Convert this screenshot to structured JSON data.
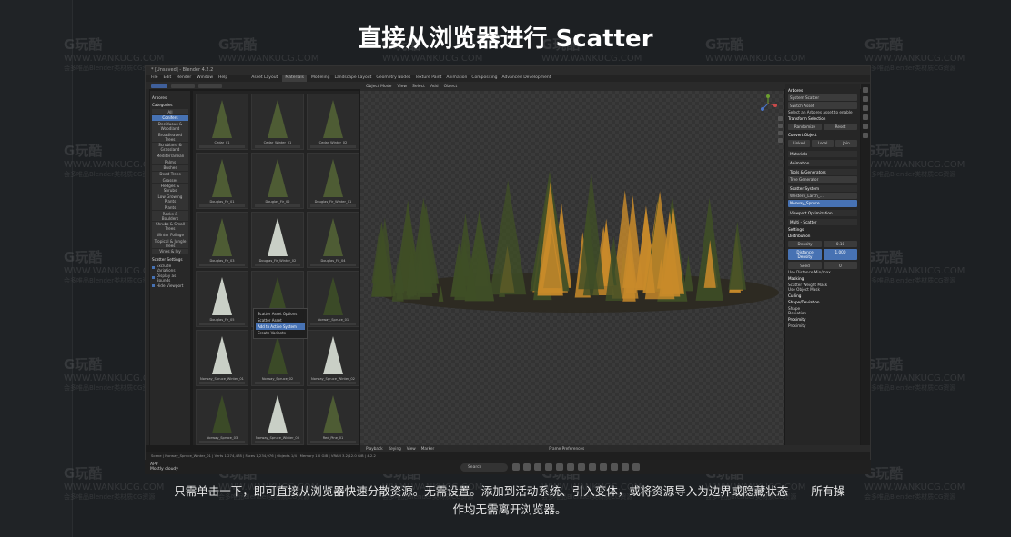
{
  "headline": "直接从浏览器进行 Scatter",
  "caption": "只需单击一下，即可直接从浏览器快速分散资源。无需设置。添加到活动系统、引入变体，或将资源导入为边界或隐藏状态——所有操作均无需离开浏览器。",
  "watermark": {
    "logo": "G玩酷",
    "domain": "WWW.WANKUCG.COM",
    "tagline": "会多唯品Blender类材质CG资源"
  },
  "screenshot": {
    "window_title": "* [Unsaved] - Blender 4.2.2",
    "menu": [
      "File",
      "Edit",
      "Render",
      "Window",
      "Help"
    ],
    "workspaces": [
      "Asset Layout",
      "Materials",
      "Modeling",
      "Landscape Layout",
      "Geometry Nodes",
      "Texture Paint",
      "Animation",
      "Compositing",
      "Advanced Development"
    ],
    "active_workspace": "Materials",
    "viewport_menu": [
      "Object Mode",
      "View",
      "Select",
      "Add",
      "Object"
    ],
    "sidebar": {
      "library_label": "Arbores",
      "categories_label": "Categories",
      "categories": [
        "All",
        "Conifers",
        "Deciduous & Woodland",
        "Broadleaved Trees",
        "Scrubland & Grassland",
        "Mediterranean",
        "Palms",
        "Bushes",
        "Dead Trees",
        "Grasses",
        "Hedges & Shrubs",
        "Low Growing Plants",
        "Plants",
        "Rocks & Boulders",
        "Shrubs & Small Trees",
        "Winter Foliage",
        "Tropical & Jungle Trees",
        "Vines & Ivy"
      ],
      "active_category": "Conifers",
      "scatter_label": "Scatter Settings",
      "checkbox_1": "Exclude Variations",
      "checkbox_2": "Display as Bounds",
      "checkbox_3": "Hide Viewport"
    },
    "assets": [
      {
        "name": "Cedar_01",
        "style": "normal"
      },
      {
        "name": "Cedar_Winter_01",
        "style": "normal"
      },
      {
        "name": "Cedar_Winter_02",
        "style": "normal"
      },
      {
        "name": "Douglas_Fir_01",
        "style": "normal"
      },
      {
        "name": "Douglas_Fir_02",
        "style": "normal"
      },
      {
        "name": "Douglas_Fir_Winter_01",
        "style": "normal"
      },
      {
        "name": "Douglas_Fir_03",
        "style": "normal"
      },
      {
        "name": "Douglas_Fir_Winter_02",
        "style": "snow"
      },
      {
        "name": "Douglas_Fir_04",
        "style": "normal"
      },
      {
        "name": "Douglas_Fir_05",
        "style": "snow"
      },
      {
        "name": "Norway_Conifer_01",
        "style": "dark"
      },
      {
        "name": "Norway_Spruce_01",
        "style": "dark"
      },
      {
        "name": "Norway_Spruce_Winter_01",
        "style": "snow"
      },
      {
        "name": "Norway_Spruce_02",
        "style": "dark"
      },
      {
        "name": "Norway_Spruce_Winter_02",
        "style": "snow"
      },
      {
        "name": "Norway_Spruce_03",
        "style": "dark"
      },
      {
        "name": "Norway_Spruce_Winter_03",
        "style": "snow"
      },
      {
        "name": "Red_Pine_01",
        "style": "normal"
      },
      {
        "name": "Red_Pine_Winter_01",
        "style": "snow"
      },
      {
        "name": "Red_Pine_02",
        "style": "normal"
      },
      {
        "name": "Red_Pine_Winter_02",
        "style": "snow"
      }
    ],
    "import_label": "Import",
    "context_menu": {
      "title": "Scatter Asset Options",
      "items": [
        "Scatter Asset",
        "Add to Active System",
        "Create Variants"
      ],
      "highlighted": 1
    },
    "right_panel": {
      "title": "Arbores",
      "system_scatter": "System Scatter",
      "scatter_asset": "Switch Asset",
      "scatter_hint": "Select an Arbores asset to enable",
      "transform_label": "Transform Selection",
      "transform_btns": [
        "Randomize",
        "Reset"
      ],
      "convert_label": "Convert Object",
      "convert_btns": [
        "Linked",
        "Local",
        "Join"
      ],
      "sections": [
        "Materials",
        "Animation",
        "Tools & Generators"
      ],
      "tree_generator": "Tree Generator",
      "scatter_system": "Scatter System",
      "list_items": [
        "Western_Larch_...",
        "Norway_Spruce..."
      ],
      "viewport_label": "Viewport Optimization",
      "multi_label": "Multi - Scatter",
      "settings": "Settings",
      "distribution": "Distribution",
      "density": "Density",
      "density_value": "0.10",
      "distance": "Distance Density",
      "distance_value": "1.000",
      "seed": "Seed",
      "seed_value": "0",
      "use_distance": "Use Distance Min/max",
      "masking": "Masking",
      "scatter_weight": "Scatter Weight Mask",
      "object_mask": "Use Object Mask",
      "culling": "Culling",
      "shape": "Shape/Deviation",
      "shape_opts": [
        "Shape",
        "Deviation"
      ],
      "proximity": "Proximity",
      "proximity_opt": "Proximity"
    },
    "timeline_items": [
      "Playback",
      "Keying",
      "View",
      "Marker"
    ],
    "timeline_center": "Frame Preferences",
    "statusbar": "Scene | Norway_Spruce_Winter_01 | Verts 1,274,478 | Faces 1,234,976 | Objects 1/4 | Memory 1.0 GiB | VRAM 3.2/12.0 GiB | 4.2.2"
  },
  "taskbar": {
    "app_line_1": "APP",
    "app_line_2": "Mostly cloudy",
    "search_label": "Search"
  },
  "colors": {
    "accent": "#4772b3",
    "autumn_orange": "#c88a2a",
    "conifer_green": "#3f4e26"
  }
}
